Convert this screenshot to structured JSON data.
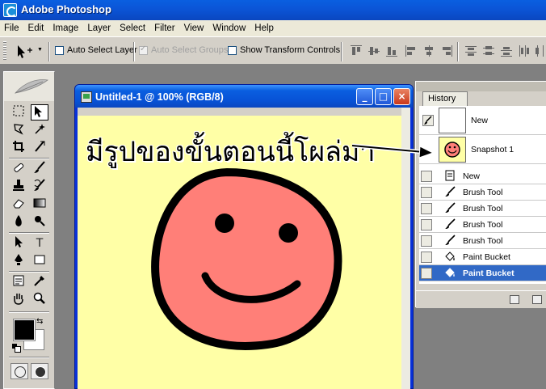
{
  "app": {
    "title": "Adobe Photoshop",
    "icon": "photoshop-icon",
    "accent": "#0a5fe0"
  },
  "menu": [
    "File",
    "Edit",
    "Image",
    "Layer",
    "Select",
    "Filter",
    "View",
    "Window",
    "Help"
  ],
  "options_bar": {
    "tool_icon": "move-tool-icon",
    "auto_select_layer": {
      "label": "Auto Select Layer",
      "checked": false
    },
    "auto_select_groups": {
      "label": "Auto Select Groups",
      "checked": true,
      "disabled": true
    },
    "show_transform_controls": {
      "label": "Show Transform Controls",
      "checked": false
    }
  },
  "document": {
    "title": "Untitled-1 @ 100% (RGB/8)",
    "buttons": [
      "_",
      "□",
      "×"
    ],
    "canvas_color": "#ffffa6",
    "face_color": "#ff7f78"
  },
  "annotation": {
    "text": "มีรูปของขั้นตอนนี้โผล่มา"
  },
  "colors": {
    "foreground": "#000000",
    "background": "#ffffff"
  },
  "history": {
    "tab_label": "History",
    "snapshots": [
      {
        "label": "New",
        "thumb": "blank"
      },
      {
        "label": "Snapshot 1",
        "thumb": "smiley"
      }
    ],
    "states": [
      {
        "label": "New",
        "icon": "document-icon"
      },
      {
        "label": "Brush Tool",
        "icon": "brush-icon"
      },
      {
        "label": "Brush Tool",
        "icon": "brush-icon"
      },
      {
        "label": "Brush Tool",
        "icon": "brush-icon"
      },
      {
        "label": "Brush Tool",
        "icon": "brush-icon"
      },
      {
        "label": "Paint Bucket",
        "icon": "paint-bucket-icon"
      },
      {
        "label": "Paint Bucket",
        "icon": "paint-bucket-icon",
        "selected": true
      }
    ],
    "selection_color": "#3169c6"
  }
}
